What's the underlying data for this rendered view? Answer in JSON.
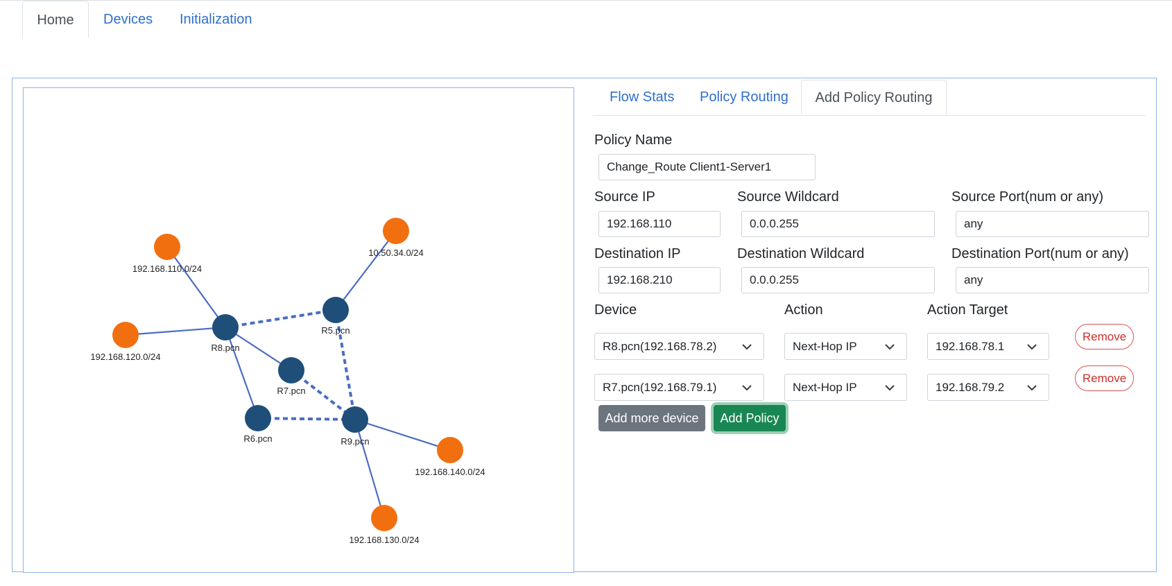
{
  "main_tabs": [
    {
      "label": "Home",
      "active": true
    },
    {
      "label": "Devices",
      "active": false
    },
    {
      "label": "Initialization",
      "active": false
    }
  ],
  "topology": {
    "colors": {
      "router": "#1f4e79",
      "subnet": "#f26f10",
      "link": "#4a6cc4"
    },
    "nodes": [
      {
        "id": "R8",
        "label": "R8.pcn",
        "kind": "router"
      },
      {
        "id": "R5",
        "label": "R5.pcn",
        "kind": "router"
      },
      {
        "id": "R7",
        "label": "R7.pcn",
        "kind": "router"
      },
      {
        "id": "R6",
        "label": "R6.pcn",
        "kind": "router"
      },
      {
        "id": "R9",
        "label": "R9.pcn",
        "kind": "router"
      },
      {
        "id": "S110",
        "label": "192.168.110.0/24",
        "kind": "subnet"
      },
      {
        "id": "S120",
        "label": "192.168.120.0/24",
        "kind": "subnet"
      },
      {
        "id": "S10",
        "label": "10.50.34.0/24",
        "kind": "subnet"
      },
      {
        "id": "S140",
        "label": "192.168.140.0/24",
        "kind": "subnet"
      },
      {
        "id": "S130",
        "label": "192.168.130.0/24",
        "kind": "subnet"
      }
    ],
    "links": [
      {
        "source": "S110",
        "target": "R8",
        "style": "solid"
      },
      {
        "source": "S120",
        "target": "R8",
        "style": "solid"
      },
      {
        "source": "S10",
        "target": "R5",
        "style": "solid"
      },
      {
        "source": "R8",
        "target": "R5",
        "style": "dashed"
      },
      {
        "source": "R8",
        "target": "R7",
        "style": "solid"
      },
      {
        "source": "R8",
        "target": "R6",
        "style": "solid"
      },
      {
        "source": "R5",
        "target": "R9",
        "style": "dashed"
      },
      {
        "source": "R7",
        "target": "R9",
        "style": "dashed"
      },
      {
        "source": "R6",
        "target": "R9",
        "style": "dashed"
      },
      {
        "source": "R9",
        "target": "S140",
        "style": "solid"
      },
      {
        "source": "R9",
        "target": "S130",
        "style": "solid"
      }
    ]
  },
  "panel_tabs": [
    {
      "label": "Flow Stats",
      "active": false
    },
    {
      "label": "Policy Routing",
      "active": false
    },
    {
      "label": "Add Policy Routing",
      "active": true
    }
  ],
  "form": {
    "policy_name_label": "Policy Name",
    "policy_name_value": "Change_Route Client1-Server1",
    "source_ip_label": "Source IP",
    "source_ip_value": "192.168.110",
    "source_wildcard_label": "Source Wildcard",
    "source_wildcard_value": "0.0.0.255",
    "source_port_label": "Source Port(num or any)",
    "source_port_value": "any",
    "dest_ip_label": "Destination IP",
    "dest_ip_value": "192.168.210",
    "dest_wildcard_label": "Destination Wildcard",
    "dest_wildcard_value": "0.0.0.255",
    "dest_port_label": "Destination Port(num or any)",
    "dest_port_value": "any",
    "device_col_label": "Device",
    "action_col_label": "Action",
    "target_col_label": "Action Target",
    "rows": [
      {
        "device": "R8.pcn(192.168.78.2)",
        "action": "Next-Hop IP",
        "target": "192.168.78.1",
        "remove": "Remove"
      },
      {
        "device": "R7.pcn(192.168.79.1)",
        "action": "Next-Hop IP",
        "target": "192.168.79.2",
        "remove": "Remove"
      }
    ],
    "add_more_label": "Add more device",
    "add_policy_label": "Add Policy"
  }
}
